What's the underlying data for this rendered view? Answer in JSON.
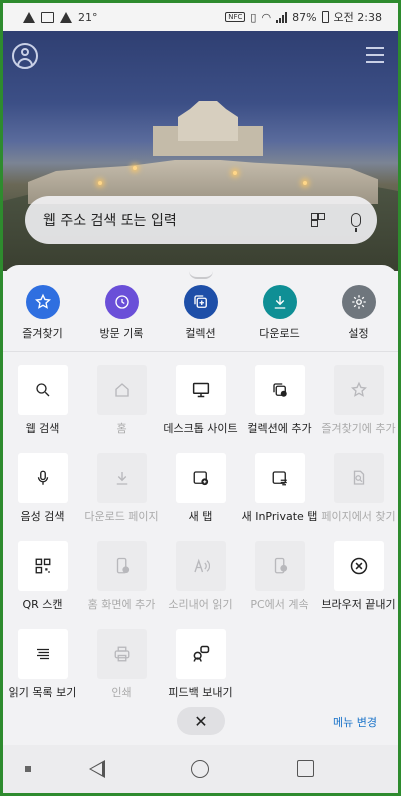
{
  "status_bar": {
    "temperature": "21°",
    "nfc": "NFC",
    "battery": "87%",
    "time": "오전 2:38"
  },
  "search": {
    "placeholder": "웹 주소 검색 또는 입력"
  },
  "quick_actions": [
    {
      "label": "즐겨찾기",
      "icon": "star-icon",
      "color": "#2f6fe0"
    },
    {
      "label": "방문 기록",
      "icon": "history-icon",
      "color": "#6a4fd8"
    },
    {
      "label": "컬렉션",
      "icon": "collections-icon",
      "color": "#1e4fa8"
    },
    {
      "label": "다운로드",
      "icon": "download-icon",
      "color": "#0f8f95"
    },
    {
      "label": "설정",
      "icon": "gear-icon",
      "color": "#6f767d"
    }
  ],
  "menu_items": [
    {
      "label": "웹 검색",
      "icon": "search-icon",
      "enabled": true
    },
    {
      "label": "홈",
      "icon": "home-icon",
      "enabled": false
    },
    {
      "label": "데스크톱 사이트",
      "icon": "desktop-icon",
      "enabled": true
    },
    {
      "label": "컬렉션에 추가",
      "icon": "add-to-collection-icon",
      "enabled": true
    },
    {
      "label": "즐겨찾기에 추가",
      "icon": "add-favorite-icon",
      "enabled": false
    },
    {
      "label": "음성 검색",
      "icon": "mic-icon",
      "enabled": true
    },
    {
      "label": "다운로드 페이지",
      "icon": "download-page-icon",
      "enabled": false
    },
    {
      "label": "새 탭",
      "icon": "new-tab-icon",
      "enabled": true
    },
    {
      "label": "새 InPrivate 탭",
      "icon": "inprivate-tab-icon",
      "enabled": true
    },
    {
      "label": "페이지에서 찾기",
      "icon": "find-in-page-icon",
      "enabled": false
    },
    {
      "label": "QR 스캔",
      "icon": "qr-icon",
      "enabled": true
    },
    {
      "label": "홈 화면에 추가",
      "icon": "add-home-screen-icon",
      "enabled": false
    },
    {
      "label": "소리내어 읽기",
      "icon": "read-aloud-icon",
      "enabled": false
    },
    {
      "label": "PC에서 계속",
      "icon": "continue-pc-icon",
      "enabled": false
    },
    {
      "label": "브라우저 끝내기",
      "icon": "exit-icon",
      "enabled": true
    },
    {
      "label": "읽기 목록 보기",
      "icon": "reading-list-icon",
      "enabled": true
    },
    {
      "label": "인쇄",
      "icon": "print-icon",
      "enabled": false
    },
    {
      "label": "피드백 보내기",
      "icon": "feedback-icon",
      "enabled": true
    }
  ],
  "menu_change_label": "메뉴 변경",
  "close_glyph": "✕"
}
